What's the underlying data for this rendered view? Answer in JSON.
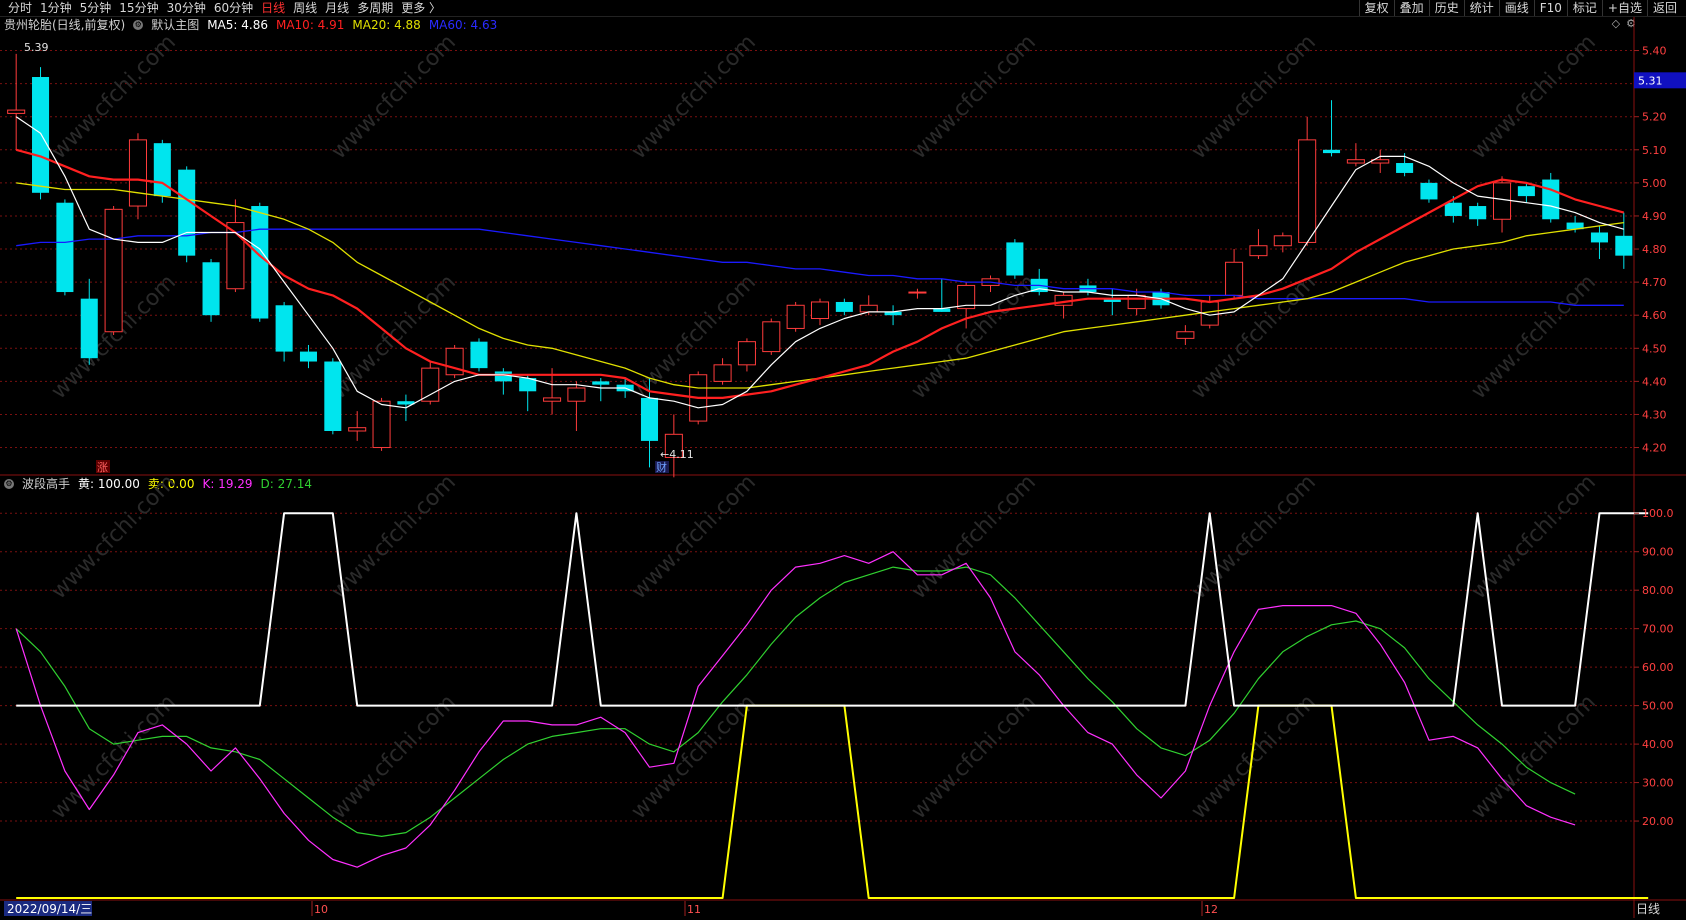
{
  "toolbar": {
    "left_items": [
      "分时",
      "1分钟",
      "5分钟",
      "15分钟",
      "30分钟",
      "60分钟",
      "日线",
      "周线",
      "月线",
      "多周期",
      "更多 〉"
    ],
    "active_index": 6,
    "right_items": [
      "复权",
      "叠加",
      "历史",
      "统计",
      "画线",
      "F10",
      "标记",
      "+自选",
      "返回"
    ]
  },
  "main_legend": {
    "title": "贵州轮胎(日线,前复权)",
    "chart_name": "默认主图",
    "ma5": "MA5: 4.86",
    "ma10": "MA10: 4.91",
    "ma20": "MA20: 4.88",
    "ma60": "MA60: 4.63"
  },
  "sub_legend": {
    "title": "波段高手",
    "huang": "黄: 100.00",
    "mai": "卖: 0.00",
    "k": "K: 19.29",
    "d": "D: 27.14"
  },
  "annotations": {
    "high": "5.39",
    "low": "←4.11",
    "cai": "财",
    "zhang": "涨"
  },
  "current_price": "5.31",
  "footer": {
    "date": "2022/09/14/三",
    "months": [
      "10",
      "11",
      "12"
    ],
    "period": "日线"
  },
  "colors": {
    "up": "#ff3c3c",
    "down": "#00e5ee",
    "ma5": "#ffffff",
    "ma10": "#ff2020",
    "ma20": "#e0e000",
    "ma60": "#1a1aff",
    "k": "#ff30ff",
    "d": "#30d030",
    "huang": "#ffffff",
    "mai": "#ffff00",
    "grid": "#7a1010"
  },
  "chart_data": [
    {
      "type": "candlestick",
      "title": "贵州轮胎(日线,前复权)",
      "y_ticks": [
        "5.40",
        "5.30",
        "5.20",
        "5.10",
        "5.00",
        "4.90",
        "4.80",
        "4.70",
        "4.60",
        "4.50",
        "4.40",
        "4.30",
        "4.20"
      ],
      "ylim": [
        4.12,
        5.45
      ],
      "candles": [
        {
          "o": 5.21,
          "h": 5.39,
          "l": 5.1,
          "c": 5.22
        },
        {
          "o": 5.32,
          "h": 5.35,
          "l": 4.95,
          "c": 4.97
        },
        {
          "o": 4.94,
          "h": 4.95,
          "l": 4.66,
          "c": 4.67
        },
        {
          "o": 4.65,
          "h": 4.71,
          "l": 4.45,
          "c": 4.47
        },
        {
          "o": 4.55,
          "h": 4.93,
          "l": 4.54,
          "c": 4.92
        },
        {
          "o": 4.93,
          "h": 5.15,
          "l": 4.89,
          "c": 5.13
        },
        {
          "o": 5.12,
          "h": 5.13,
          "l": 4.94,
          "c": 4.96
        },
        {
          "o": 5.04,
          "h": 5.05,
          "l": 4.76,
          "c": 4.78
        },
        {
          "o": 4.76,
          "h": 4.77,
          "l": 4.58,
          "c": 4.6
        },
        {
          "o": 4.68,
          "h": 4.95,
          "l": 4.67,
          "c": 4.88
        },
        {
          "o": 4.93,
          "h": 4.94,
          "l": 4.58,
          "c": 4.59
        },
        {
          "o": 4.63,
          "h": 4.64,
          "l": 4.46,
          "c": 4.49
        },
        {
          "o": 4.49,
          "h": 4.51,
          "l": 4.44,
          "c": 4.46
        },
        {
          "o": 4.46,
          "h": 4.47,
          "l": 4.24,
          "c": 4.25
        },
        {
          "o": 4.25,
          "h": 4.31,
          "l": 4.22,
          "c": 4.26
        },
        {
          "o": 4.2,
          "h": 4.35,
          "l": 4.19,
          "c": 4.34
        },
        {
          "o": 4.34,
          "h": 4.36,
          "l": 4.28,
          "c": 4.33
        },
        {
          "o": 4.34,
          "h": 4.46,
          "l": 4.33,
          "c": 4.44
        },
        {
          "o": 4.42,
          "h": 4.51,
          "l": 4.41,
          "c": 4.5
        },
        {
          "o": 4.52,
          "h": 4.53,
          "l": 4.43,
          "c": 4.44
        },
        {
          "o": 4.43,
          "h": 4.44,
          "l": 4.36,
          "c": 4.4
        },
        {
          "o": 4.41,
          "h": 4.42,
          "l": 4.31,
          "c": 4.37
        },
        {
          "o": 4.34,
          "h": 4.44,
          "l": 4.3,
          "c": 4.35
        },
        {
          "o": 4.34,
          "h": 4.4,
          "l": 4.25,
          "c": 4.38
        },
        {
          "o": 4.4,
          "h": 4.41,
          "l": 4.34,
          "c": 4.39
        },
        {
          "o": 4.39,
          "h": 4.41,
          "l": 4.35,
          "c": 4.37
        },
        {
          "o": 4.35,
          "h": 4.41,
          "l": 4.14,
          "c": 4.22
        },
        {
          "o": 4.17,
          "h": 4.3,
          "l": 4.11,
          "c": 4.24
        },
        {
          "o": 4.28,
          "h": 4.43,
          "l": 4.27,
          "c": 4.42
        },
        {
          "o": 4.4,
          "h": 4.47,
          "l": 4.39,
          "c": 4.45
        },
        {
          "o": 4.45,
          "h": 4.53,
          "l": 4.43,
          "c": 4.52
        },
        {
          "o": 4.49,
          "h": 4.59,
          "l": 4.48,
          "c": 4.58
        },
        {
          "o": 4.56,
          "h": 4.64,
          "l": 4.55,
          "c": 4.63
        },
        {
          "o": 4.59,
          "h": 4.65,
          "l": 4.57,
          "c": 4.64
        },
        {
          "o": 4.64,
          "h": 4.65,
          "l": 4.6,
          "c": 4.61
        },
        {
          "o": 4.61,
          "h": 4.66,
          "l": 4.6,
          "c": 4.63
        },
        {
          "o": 4.61,
          "h": 4.63,
          "l": 4.57,
          "c": 4.6
        },
        {
          "o": 4.67,
          "h": 4.68,
          "l": 4.65,
          "c": 4.67
        },
        {
          "o": 4.62,
          "h": 4.71,
          "l": 4.61,
          "c": 4.61
        },
        {
          "o": 4.62,
          "h": 4.7,
          "l": 4.56,
          "c": 4.69
        },
        {
          "o": 4.69,
          "h": 4.72,
          "l": 4.67,
          "c": 4.71
        },
        {
          "o": 4.82,
          "h": 4.83,
          "l": 4.71,
          "c": 4.72
        },
        {
          "o": 4.71,
          "h": 4.74,
          "l": 4.66,
          "c": 4.67
        },
        {
          "o": 4.63,
          "h": 4.67,
          "l": 4.59,
          "c": 4.66
        },
        {
          "o": 4.69,
          "h": 4.71,
          "l": 4.66,
          "c": 4.67
        },
        {
          "o": 4.65,
          "h": 4.68,
          "l": 4.6,
          "c": 4.64
        },
        {
          "o": 4.62,
          "h": 4.68,
          "l": 4.6,
          "c": 4.66
        },
        {
          "o": 4.67,
          "h": 4.68,
          "l": 4.62,
          "c": 4.63
        },
        {
          "o": 4.53,
          "h": 4.57,
          "l": 4.51,
          "c": 4.55
        },
        {
          "o": 4.57,
          "h": 4.66,
          "l": 4.56,
          "c": 4.64
        },
        {
          "o": 4.66,
          "h": 4.8,
          "l": 4.65,
          "c": 4.76
        },
        {
          "o": 4.78,
          "h": 4.86,
          "l": 4.77,
          "c": 4.81
        },
        {
          "o": 4.81,
          "h": 4.85,
          "l": 4.79,
          "c": 4.84
        },
        {
          "o": 4.82,
          "h": 5.2,
          "l": 4.81,
          "c": 5.13
        },
        {
          "o": 5.1,
          "h": 5.25,
          "l": 5.08,
          "c": 5.09
        },
        {
          "o": 5.06,
          "h": 5.12,
          "l": 5.05,
          "c": 5.07
        },
        {
          "o": 5.06,
          "h": 5.1,
          "l": 5.03,
          "c": 5.07
        },
        {
          "o": 5.06,
          "h": 5.09,
          "l": 5.02,
          "c": 5.03
        },
        {
          "o": 5.0,
          "h": 5.01,
          "l": 4.94,
          "c": 4.95
        },
        {
          "o": 4.94,
          "h": 4.96,
          "l": 4.88,
          "c": 4.9
        },
        {
          "o": 4.93,
          "h": 4.94,
          "l": 4.87,
          "c": 4.89
        },
        {
          "o": 4.89,
          "h": 5.02,
          "l": 4.85,
          "c": 5.0
        },
        {
          "o": 4.99,
          "h": 5.0,
          "l": 4.94,
          "c": 4.96
        },
        {
          "o": 5.01,
          "h": 5.03,
          "l": 4.88,
          "c": 4.89
        },
        {
          "o": 4.88,
          "h": 4.9,
          "l": 4.85,
          "c": 4.86
        },
        {
          "o": 4.85,
          "h": 4.87,
          "l": 4.77,
          "c": 4.82
        },
        {
          "o": 4.84,
          "h": 4.91,
          "l": 4.74,
          "c": 4.78
        }
      ],
      "ma5": [
        5.2,
        5.15,
        5.02,
        4.86,
        4.83,
        4.82,
        4.82,
        4.85,
        4.85,
        4.85,
        4.8,
        4.7,
        4.6,
        4.5,
        4.37,
        4.33,
        4.32,
        4.36,
        4.4,
        4.42,
        4.42,
        4.41,
        4.39,
        4.39,
        4.38,
        4.38,
        4.35,
        4.34,
        4.32,
        4.33,
        4.37,
        4.45,
        4.52,
        4.56,
        4.59,
        4.61,
        4.61,
        4.62,
        4.62,
        4.63,
        4.63,
        4.66,
        4.68,
        4.67,
        4.67,
        4.66,
        4.66,
        4.65,
        4.62,
        4.6,
        4.61,
        4.66,
        4.71,
        4.82,
        4.93,
        5.04,
        5.08,
        5.08,
        5.05,
        5.0,
        4.96,
        4.95,
        4.94,
        4.93,
        4.91,
        4.88,
        4.86
      ],
      "ma10": [
        5.1,
        5.08,
        5.05,
        5.02,
        5.01,
        5.01,
        5.0,
        4.95,
        4.9,
        4.85,
        4.78,
        4.72,
        4.68,
        4.66,
        4.62,
        4.56,
        4.5,
        4.46,
        4.44,
        4.42,
        4.42,
        4.42,
        4.42,
        4.42,
        4.42,
        4.41,
        4.37,
        4.36,
        4.35,
        4.35,
        4.36,
        4.37,
        4.39,
        4.41,
        4.43,
        4.45,
        4.49,
        4.52,
        4.56,
        4.59,
        4.61,
        4.62,
        4.63,
        4.64,
        4.65,
        4.65,
        4.65,
        4.65,
        4.65,
        4.64,
        4.65,
        4.66,
        4.68,
        4.71,
        4.74,
        4.79,
        4.83,
        4.87,
        4.91,
        4.95,
        4.99,
        5.01,
        5.0,
        4.98,
        4.95,
        4.93,
        4.91
      ],
      "ma20": [
        5.0,
        4.99,
        4.98,
        4.98,
        4.98,
        4.97,
        4.96,
        4.95,
        4.94,
        4.93,
        4.91,
        4.89,
        4.86,
        4.82,
        4.76,
        4.72,
        4.68,
        4.64,
        4.6,
        4.56,
        4.53,
        4.51,
        4.5,
        4.48,
        4.46,
        4.44,
        4.41,
        4.39,
        4.38,
        4.38,
        4.38,
        4.39,
        4.4,
        4.41,
        4.42,
        4.43,
        4.44,
        4.45,
        4.46,
        4.47,
        4.49,
        4.51,
        4.53,
        4.55,
        4.56,
        4.57,
        4.58,
        4.59,
        4.6,
        4.61,
        4.62,
        4.63,
        4.64,
        4.65,
        4.67,
        4.7,
        4.73,
        4.76,
        4.78,
        4.8,
        4.81,
        4.82,
        4.84,
        4.85,
        4.86,
        4.87,
        4.88
      ],
      "ma60": [
        4.81,
        4.82,
        4.82,
        4.83,
        4.83,
        4.84,
        4.84,
        4.84,
        4.85,
        4.85,
        4.86,
        4.86,
        4.86,
        4.86,
        4.86,
        4.86,
        4.86,
        4.86,
        4.86,
        4.86,
        4.85,
        4.84,
        4.83,
        4.82,
        4.81,
        4.8,
        4.79,
        4.78,
        4.77,
        4.76,
        4.76,
        4.75,
        4.74,
        4.74,
        4.73,
        4.72,
        4.72,
        4.71,
        4.71,
        4.7,
        4.7,
        4.69,
        4.69,
        4.68,
        4.68,
        4.68,
        4.67,
        4.67,
        4.66,
        4.66,
        4.66,
        4.65,
        4.65,
        4.65,
        4.65,
        4.65,
        4.65,
        4.65,
        4.64,
        4.64,
        4.64,
        4.64,
        4.64,
        4.64,
        4.63,
        4.63,
        4.63
      ]
    },
    {
      "type": "line",
      "title": "波段高手",
      "y_ticks": [
        "100.0",
        "90.00",
        "80.00",
        "70.00",
        "60.00",
        "50.00",
        "40.00",
        "30.00",
        "20.00"
      ],
      "ylim": [
        0,
        105
      ],
      "series": [
        {
          "name": "黄",
          "values": [
            50,
            50,
            50,
            50,
            50,
            50,
            50,
            50,
            50,
            50,
            50,
            100,
            100,
            100,
            50,
            50,
            50,
            50,
            50,
            50,
            50,
            50,
            50,
            100,
            50,
            50,
            50,
            50,
            50,
            50,
            50,
            50,
            50,
            50,
            50,
            50,
            50,
            50,
            50,
            50,
            50,
            50,
            50,
            50,
            50,
            50,
            50,
            50,
            50,
            100,
            50,
            50,
            50,
            50,
            50,
            50,
            50,
            50,
            50,
            50,
            100,
            50,
            50,
            50,
            50,
            100,
            100,
            100
          ]
        },
        {
          "name": "卖",
          "values": [
            0,
            0,
            0,
            0,
            0,
            0,
            0,
            0,
            0,
            0,
            0,
            0,
            0,
            0,
            0,
            0,
            0,
            0,
            0,
            0,
            0,
            0,
            0,
            0,
            0,
            0,
            0,
            0,
            0,
            0,
            50,
            50,
            50,
            50,
            50,
            0,
            0,
            0,
            0,
            0,
            0,
            0,
            0,
            0,
            0,
            0,
            0,
            0,
            0,
            0,
            0,
            50,
            50,
            50,
            50,
            0,
            0,
            0,
            0,
            0,
            0,
            0,
            0,
            0,
            0,
            0,
            0,
            0
          ]
        },
        {
          "name": "K",
          "values": [
            70,
            50,
            33,
            23,
            32,
            43,
            45,
            40,
            33,
            39,
            31,
            22,
            15,
            10,
            8,
            11,
            13,
            19,
            28,
            38,
            46,
            46,
            45,
            45,
            47,
            43,
            34,
            35,
            55,
            63,
            71,
            80,
            86,
            87,
            89,
            87,
            90,
            84,
            84,
            87,
            78,
            64,
            58,
            50,
            43,
            40,
            32,
            26,
            33,
            50,
            64,
            75,
            76,
            76,
            76,
            74,
            66,
            56,
            41,
            42,
            39,
            31,
            24,
            21,
            19
          ]
        },
        {
          "name": "D",
          "values": [
            70,
            64,
            55,
            44,
            40,
            41,
            42,
            42,
            39,
            38,
            36,
            31,
            26,
            21,
            17,
            16,
            17,
            21,
            26,
            31,
            36,
            40,
            42,
            43,
            44,
            44,
            40,
            38,
            43,
            51,
            58,
            66,
            73,
            78,
            82,
            84,
            86,
            85,
            85,
            86,
            84,
            78,
            71,
            64,
            57,
            51,
            44,
            39,
            37,
            41,
            48,
            57,
            64,
            68,
            71,
            72,
            70,
            65,
            57,
            51,
            45,
            40,
            34,
            30,
            27
          ]
        }
      ]
    }
  ]
}
